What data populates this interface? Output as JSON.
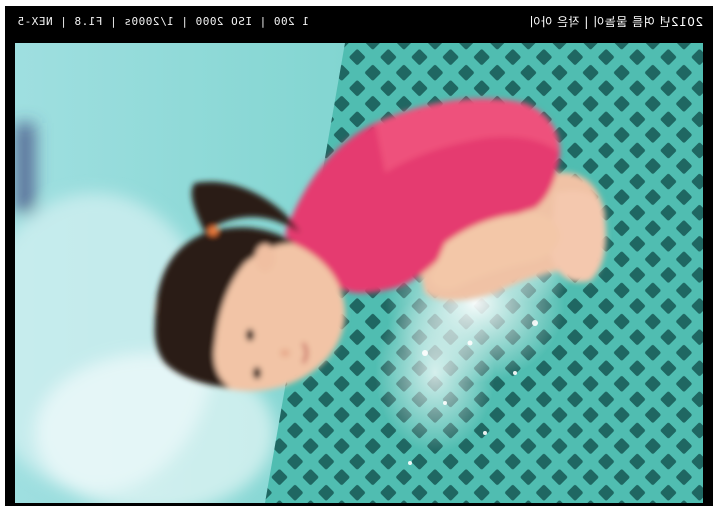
{
  "frame": {
    "exif_caption": "1 200 | ISO 2000 | 1/2000s | F1.8 | NEX-5",
    "title_caption": "2012년 여름 물놀이 | 작은 아이"
  },
  "photo": {
    "subject": "girl-in-pink-shirt-crouching-on-wet-pool-grate",
    "colors": {
      "frame": "#000000",
      "water": "#7fd6cf",
      "grate": "#56c2b7",
      "shirt": "#e8336e",
      "hair": "#2a1a14",
      "skin": "#f3c7a8"
    }
  }
}
